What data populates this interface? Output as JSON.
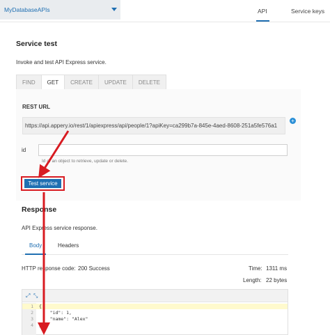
{
  "topbar": {
    "db_name": "MyDatabaseAPIs",
    "tabs": [
      {
        "label": "API",
        "active": true
      },
      {
        "label": "Service keys",
        "active": false
      }
    ]
  },
  "service_test": {
    "title": "Service test",
    "description": "Invoke and test API Express service.",
    "methods": [
      "FIND",
      "GET",
      "CREATE",
      "UPDATE",
      "DELETE"
    ],
    "active_method": "GET",
    "rest_url_label": "REST URL",
    "rest_url": "https://api.appery.io/rest/1/apiexpress/api/people/1?apiKey=ca299b7a-845e-4aed-8608-251a5fe576a1",
    "id_label": "id",
    "id_value": "",
    "id_help": "Id of an object to retrieve, update or delete.",
    "test_button": "Test service"
  },
  "response": {
    "title": "Response",
    "description": "API Express service response.",
    "tabs": [
      "Body",
      "Headers"
    ],
    "http_code_label": "HTTP response code:",
    "http_code_value": "200 Success",
    "time_label": "Time:",
    "time_value": "1311 ms",
    "length_label": "Length:",
    "length_value": "22 bytes",
    "code_lines": [
      {
        "num": "1",
        "text": "{"
      },
      {
        "num": "2",
        "text": "    \"id\": 1,"
      },
      {
        "num": "3",
        "text": "    \"name\": \"Alex\""
      },
      {
        "num": "4",
        "text": "}"
      }
    ]
  },
  "colors": {
    "accent": "#1f6fb2",
    "annotation": "#d81b21"
  },
  "icons": [
    "chevron-down-icon",
    "add-circle-icon",
    "expand-icon",
    "collapse-icon"
  ]
}
